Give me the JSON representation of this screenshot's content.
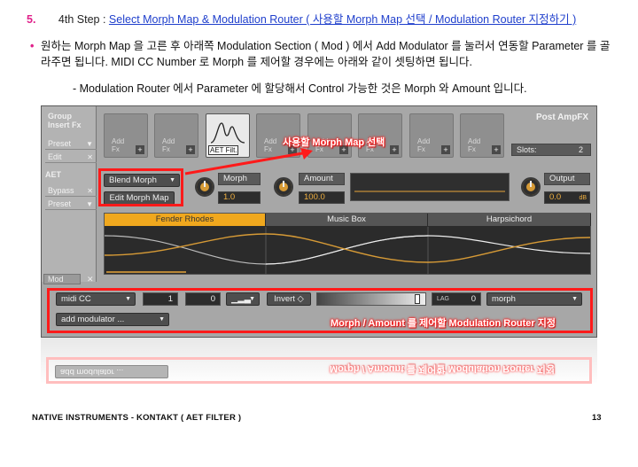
{
  "step": {
    "number": "5.",
    "label": "4th Step :",
    "link_text": "Select Morph Map & Modulation Router ( 사용할 Morph Map 선택 / Modulation Router 지정하기 )"
  },
  "bullet": {
    "text": "원하는 Morph Map 을 고른 후 아래쪽 Modulation Section ( Mod ) 에서 Add Modulator 를 눌러서 연동할 Parameter 를 골라주면 됩니다. MIDI CC Number 로 Morph 를 제어할 경우에는 아래와 같이 셋팅하면 됩니다."
  },
  "note": "- Modulation Router 에서 Parameter 에 할당해서 Control 가능한 것은 Morph 와 Amount 입니다.",
  "panel": {
    "group_insert_fx": [
      "Group",
      "Insert Fx"
    ],
    "left_rows": [
      {
        "label": "Preset",
        "mark": "▼"
      },
      {
        "label": "Edit",
        "mark": "✕"
      }
    ],
    "aet_label": "AET",
    "left_rows2": [
      {
        "label": "Bypass",
        "mark": "✕"
      },
      {
        "label": "Preset",
        "mark": "▼"
      }
    ],
    "slot_label": [
      "Add",
      "Fx"
    ],
    "slot_plus": "+",
    "aet_slot_label": "AET Filt.",
    "post_amp_fx": "Post AmpFX",
    "slots_label": "Slots:",
    "slots_value": "2",
    "blend_morph": "Blend Morph",
    "edit_morph_map": "Edit Morph Map",
    "morph_label": "Morph",
    "morph_value": "1.0",
    "amount_label": "Amount",
    "amount_value": "100.0",
    "output_label": "Output",
    "output_value": "0.0",
    "output_unit": "dB",
    "morph_tabs": [
      "Fender Rhodes",
      "Music Box",
      "Harpsichord"
    ],
    "mod_tab": "Mod",
    "mod_tab_mark": "✕",
    "midi_cc": "midi CC",
    "cc_number": "1",
    "cc_value": "0",
    "invert_label": "Invert ◇",
    "lag_label": "LAG",
    "lag_value": "0",
    "target": "morph",
    "add_modulator": "add modulator ..."
  },
  "callouts": {
    "morph_map": "사용할 Morph Map 선택",
    "router": "Morph / Amount 를 제어할 Modulation Router 지정"
  },
  "footer": {
    "left": "NATIVE INSTRUMENTS - KONTAKT ( AET FILTER )",
    "page": "13"
  },
  "colors": {
    "accent_pink": "#e0218a",
    "link_blue": "#1f3fcc",
    "highlight_red": "#ff1a1a",
    "knob_orange": "#d69a36",
    "active_tab": "#f0a81e"
  }
}
